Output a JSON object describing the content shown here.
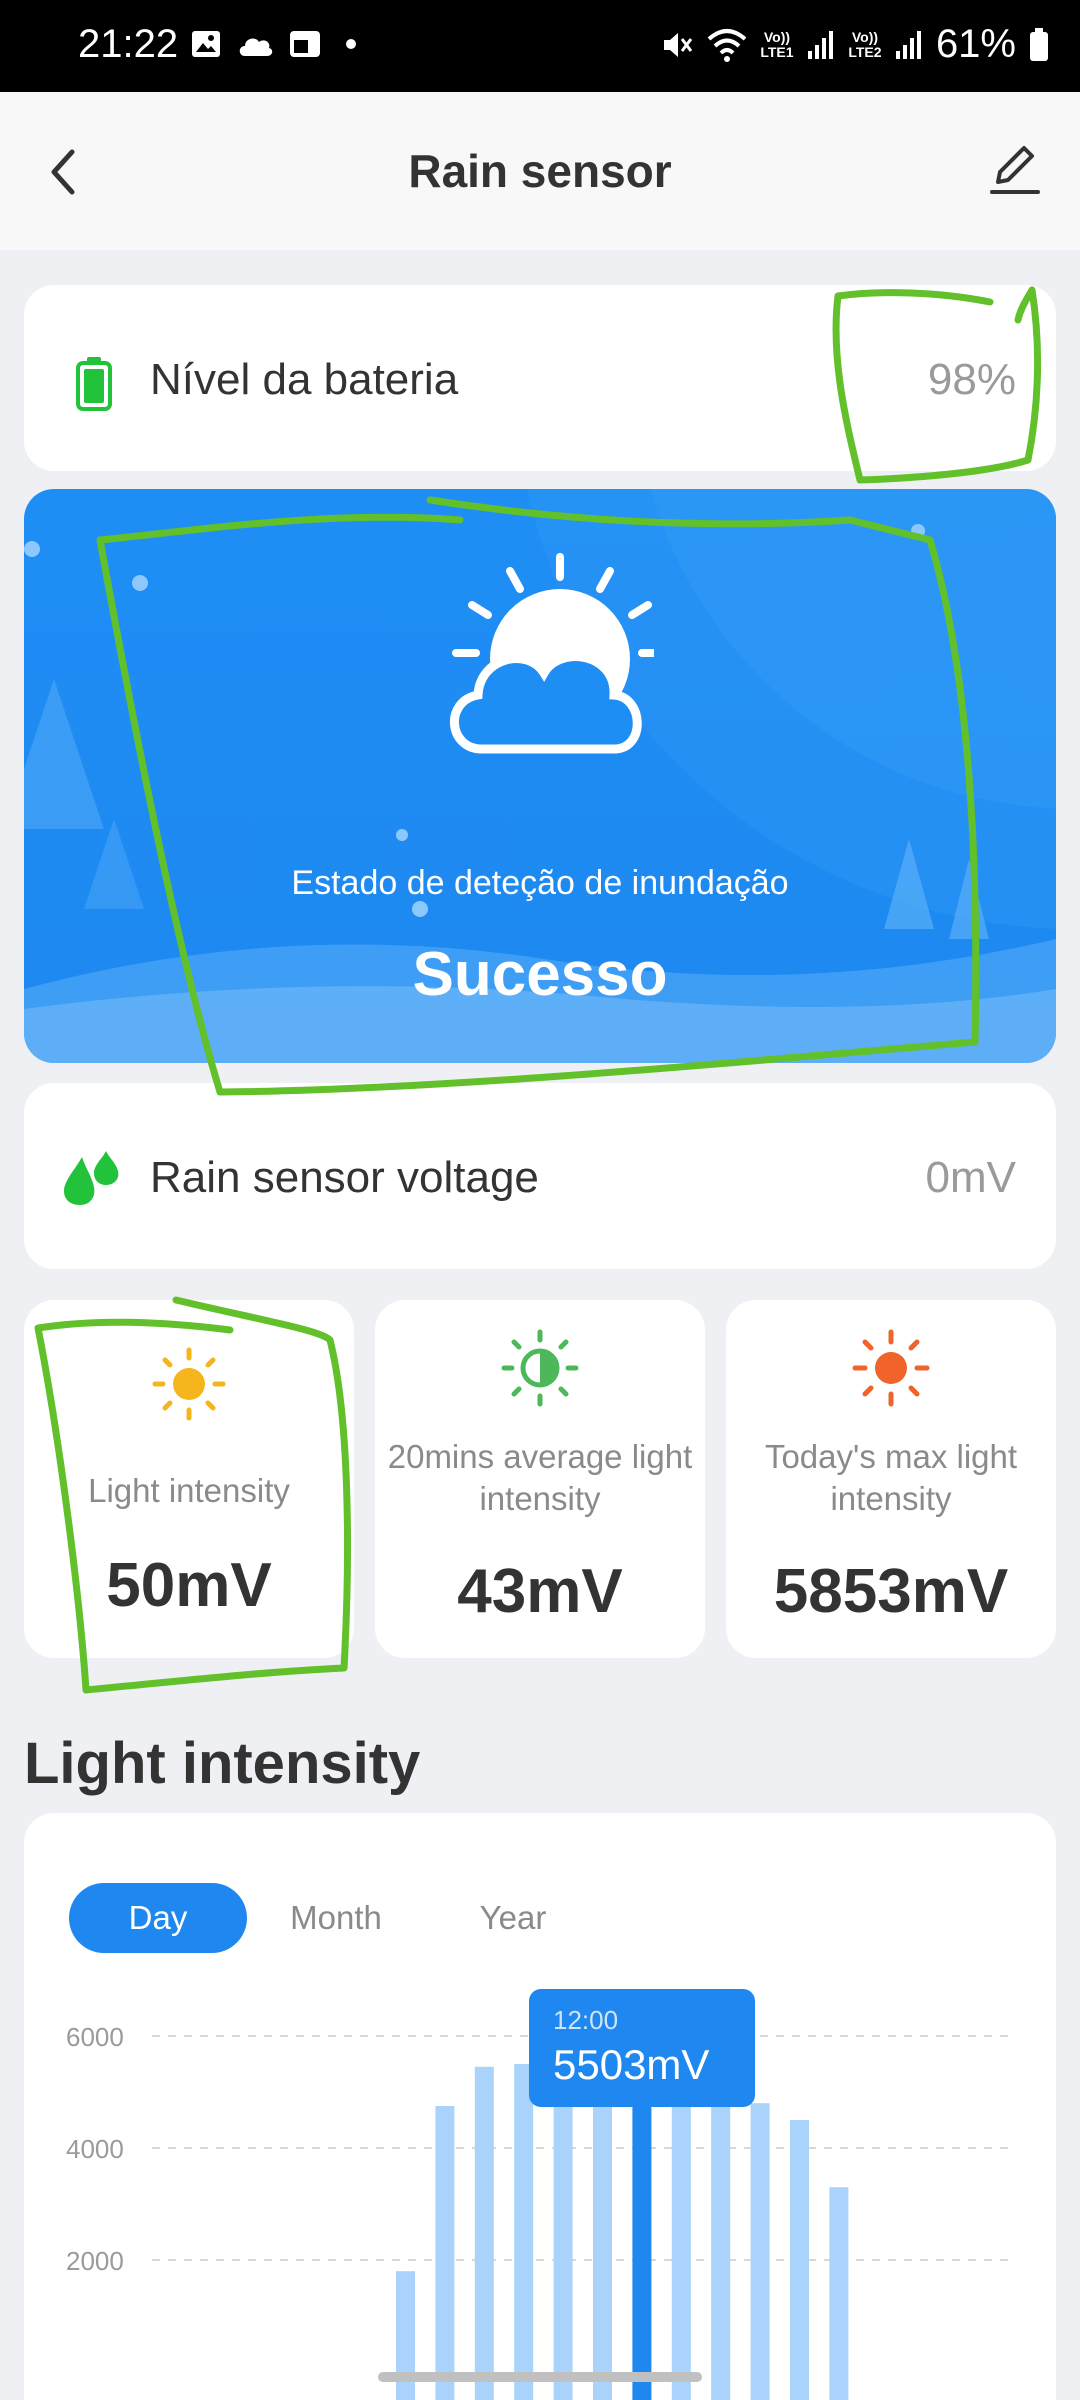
{
  "status_bar": {
    "time": "21:22",
    "battery_percent": "61%",
    "sim1": "Vo)) LTE1",
    "sim2": "Vo)) LTE2"
  },
  "header": {
    "title": "Rain sensor",
    "back_icon": "chevron-left-icon",
    "edit_icon": "edit-pencil-icon"
  },
  "battery": {
    "label": "Nível da bateria",
    "value": "98%",
    "icon": "battery-icon",
    "color": "#22c33a"
  },
  "flood_detection": {
    "label": "Estado de deteção de inundação",
    "status": "Sucesso",
    "icon": "sun-cloud-icon",
    "background": "#1e8ef5"
  },
  "voltage": {
    "label": "Rain sensor voltage",
    "value": "0mV",
    "icon": "water-drops-icon",
    "color": "#22c33a"
  },
  "metrics": [
    {
      "label": "Light intensity",
      "value": "50mV",
      "icon": "sun-icon",
      "color": "#f5b51c"
    },
    {
      "label": "20mins average light intensity",
      "value": "43mV",
      "icon": "half-sun-icon",
      "color": "#4cb85a"
    },
    {
      "label": "Today's max light intensity",
      "value": "5853mV",
      "icon": "sun-icon",
      "color": "#f0632a"
    }
  ],
  "chart_section": {
    "title": "Light intensity",
    "tabs": [
      "Day",
      "Month",
      "Year"
    ],
    "active_tab": "Day",
    "tooltip": {
      "time": "12:00",
      "value": "5503mV"
    }
  },
  "chart_data": {
    "type": "bar",
    "y_ticks": [
      "6000",
      "4000",
      "2000"
    ],
    "ylim": [
      0,
      6000
    ],
    "series": [
      {
        "name": "",
        "values": [
          1800,
          4750,
          5450,
          5500,
          5300,
          5400,
          5503,
          5300,
          5100,
          4800,
          4500,
          3300
        ],
        "highlight_index": 6
      }
    ],
    "colors": {
      "bar": "#a9d3fb",
      "highlight": "#1e88f0"
    },
    "grid": true
  }
}
